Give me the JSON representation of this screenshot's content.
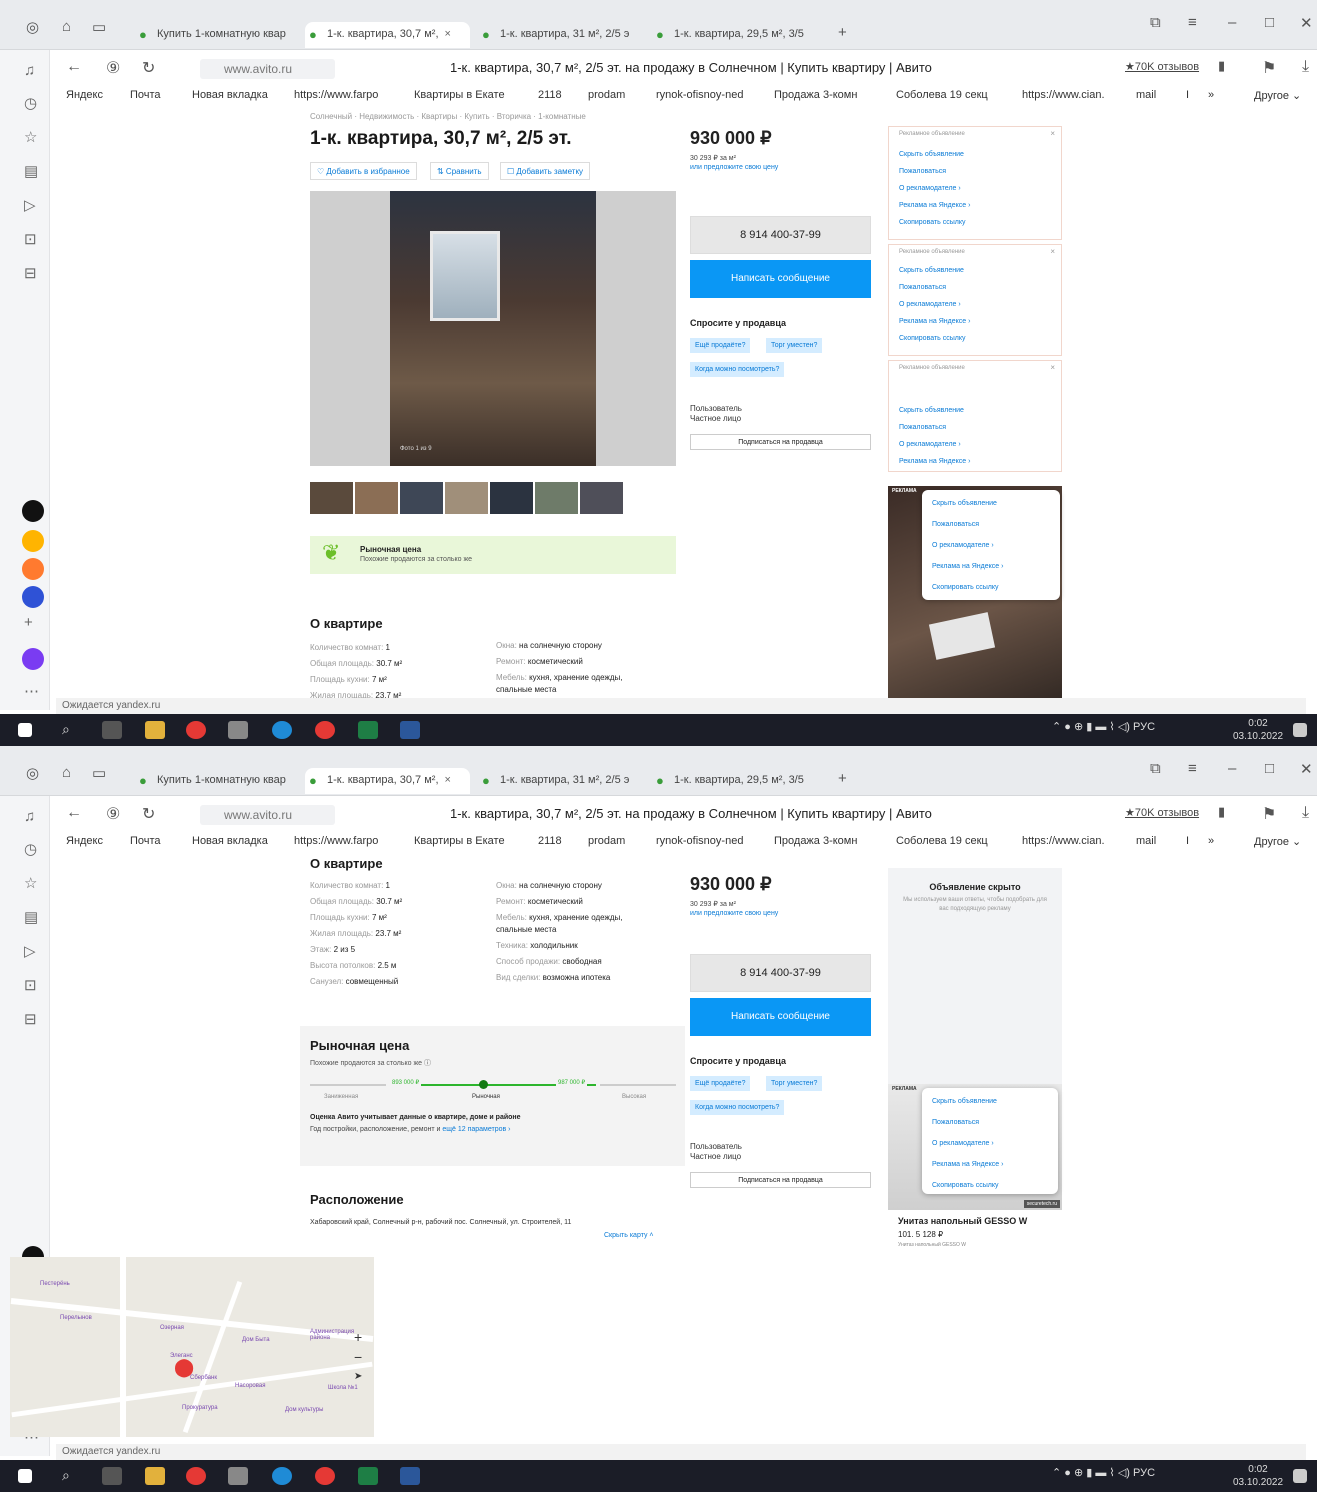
{
  "browser": {
    "tabs": [
      {
        "label": "Купить 1-комнатную квар"
      },
      {
        "label": "1-к. квартира, 30,7 м²,",
        "close": "×"
      },
      {
        "label": "1-к. квартира, 31 м², 2/5 э"
      },
      {
        "label": "1-к. квартира, 29,5 м², 3/5"
      }
    ],
    "new_tab": "+",
    "host": "www.avito.ru",
    "page_title": "1-к. квартира, 30,7 м², 2/5 эт. на продажу в Солнечном | Купить квартиру | Авито",
    "reviews": "★70K отзывов",
    "bookmarks": [
      "Яндекс",
      "Почта",
      "Новая вкладка",
      "https://www.farpo",
      "Квартиры в Екате",
      "2118",
      "prodam",
      "rynok-ofisnoy-ned",
      "Продажа 3-комн",
      "Соболева 19 секц",
      "https://www.cian.",
      "mail",
      "I",
      "»",
      "Другое ⌄"
    ],
    "status": "Ожидается yandex.ru",
    "taskbar": {
      "lang": "РУС",
      "time": "0:02",
      "date": "03.10.2022"
    }
  },
  "listing": {
    "breadcrumbs": "Солнечный · Недвижимость · Квартиры · Купить · Вторичка · 1-комнатные",
    "title": "1-к. квартира, 30,7 м², 2/5 эт.",
    "buttons": {
      "favorite": "♡ Добавить в избранное",
      "compare": "⇅ Сравнить",
      "note": "☐ Добавить заметку"
    },
    "photo_caption": "Фото 1 из 9",
    "market_banner": {
      "title": "Рыночная цена",
      "subtitle": "Похожие продаются за столько же"
    },
    "about_title": "О квартире",
    "params_left": [
      {
        "k": "Количество комнат:",
        "v": "1"
      },
      {
        "k": "Общая площадь:",
        "v": "30.7 м²"
      },
      {
        "k": "Площадь кухни:",
        "v": "7 м²"
      },
      {
        "k": "Жилая площадь:",
        "v": "23.7 м²"
      },
      {
        "k": "Этаж:",
        "v": "2 из 5"
      },
      {
        "k": "Высота потолков:",
        "v": "2.5 м"
      },
      {
        "k": "Санузел:",
        "v": "совмещенный"
      }
    ],
    "params_right": [
      {
        "k": "Окна:",
        "v": "на солнечную сторону"
      },
      {
        "k": "Ремонт:",
        "v": "косметический"
      },
      {
        "k": "Мебель:",
        "v": "кухня, хранение одежды, спальные места"
      },
      {
        "k": "Техника:",
        "v": "холодильник"
      },
      {
        "k": "Способ продажи:",
        "v": "свободная"
      },
      {
        "k": "Вид сделки:",
        "v": "возможна ипотека"
      }
    ],
    "price": "930 000 ₽",
    "price_per_m": "30 293 ₽ за м²",
    "offer_price": "или предложите свою цену",
    "phone": "8 914 400-37-99",
    "write": "Написать сообщение",
    "ask_title": "Спросите у продавца",
    "chips": [
      "Ещё продаёте?",
      "Торг уместен?",
      "Когда можно посмотреть?"
    ],
    "seller_type": "Пользователь",
    "seller_sub": "Частное лицо",
    "subscribe": "Подписаться на продавца",
    "market2": {
      "title": "Рыночная цена",
      "subtitle": "Похожие продаются за столько же ⓘ",
      "low": "893 000 ₽",
      "high": "987 000 ₽",
      "marker_fraction": 0.45,
      "labels": [
        "Заниженная",
        "Рыночная",
        "Высокая"
      ],
      "note": "Оценка Авито учитывает данные о квартире, доме и районе",
      "note2": "Год постройки, расположение, ремонт и",
      "note_link": "ещё 12 параметров ›"
    },
    "location_title": "Расположение",
    "address": "Хабаровский край, Солнечный р-н, рабочий пос. Солнечный, ул. Строителей, 11",
    "hide_map": "Скрыть карту ˄",
    "map_labels": [
      "Пестерёнь",
      "Озерная",
      "Перелынов",
      "Элеганс",
      "Дом Быта",
      "Администрация района",
      "Школа №1",
      "Дом культуры",
      "Насоровая",
      "Прокуратура",
      "Сбербанк"
    ]
  },
  "ads": {
    "header": "Рекламное объявление",
    "items": [
      "Скрыть объявление",
      "Пожаловаться",
      "О рекламодателе ›",
      "Реклама на Яндексе ›",
      "Скопировать ссылку"
    ],
    "ad_label": "РЕКЛАМА",
    "hidden_title": "Объявление скрыто",
    "hidden_text": "Мы используем ваши ответы, чтобы подобрать для вас подходящую рекламу",
    "product_title": "Унитаз напольный GESSO W",
    "product_price": "101. 5 128 ₽",
    "product_sub": "Унитаз напольный GESSO W",
    "ad_site": "securetech.ru"
  }
}
